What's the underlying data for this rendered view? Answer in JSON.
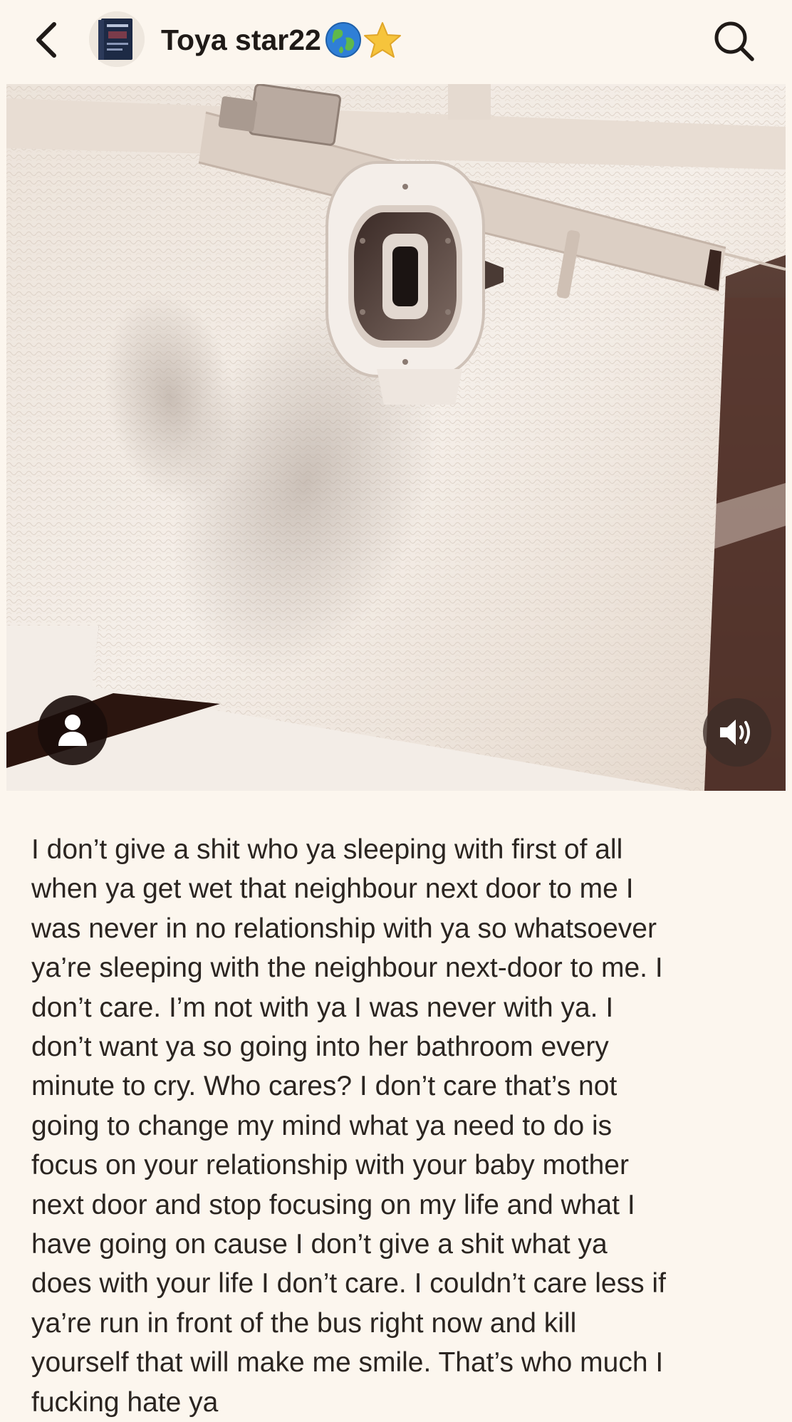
{
  "header": {
    "back_icon": "chevron-left-icon",
    "avatar_icon": "book-cover-avatar",
    "username": "Toya star22",
    "username_emojis": [
      "earth-globe-emoji",
      "star-emoji"
    ],
    "search_icon": "search-icon"
  },
  "media": {
    "description_icon": "photo",
    "profile_icon": "person-icon",
    "sound_icon": "speaker-on-icon"
  },
  "post": {
    "caption": "I don’t give a shit who ya sleeping with first of all\nwhen ya get wet that neighbour  next door to me I\nwas never in no relationship with ya so whatsoever\nya’re sleeping with the neighbour next-door to me. I\ndon’t care. I’m not with ya I was never with ya. I\ndon’t want ya so going into her bathroom every\nminute to cry. Who cares? I don’t care that’s not\ngoing to change my mind what ya need to do is\nfocus on your relationship with your baby mother\nnext door and stop focusing on my life and what I\nhave going on cause I don’t give a shit what ya\ndoes with your life I don’t care. I couldn’t care less if\nya’re run in  front of the bus right now and kill\nyourself that will make me smile. That’s who much I\nfucking hate ya"
  },
  "colors": {
    "background": "#fcf6ee",
    "text": "#2b2521",
    "button_dark": "#190c0a"
  }
}
